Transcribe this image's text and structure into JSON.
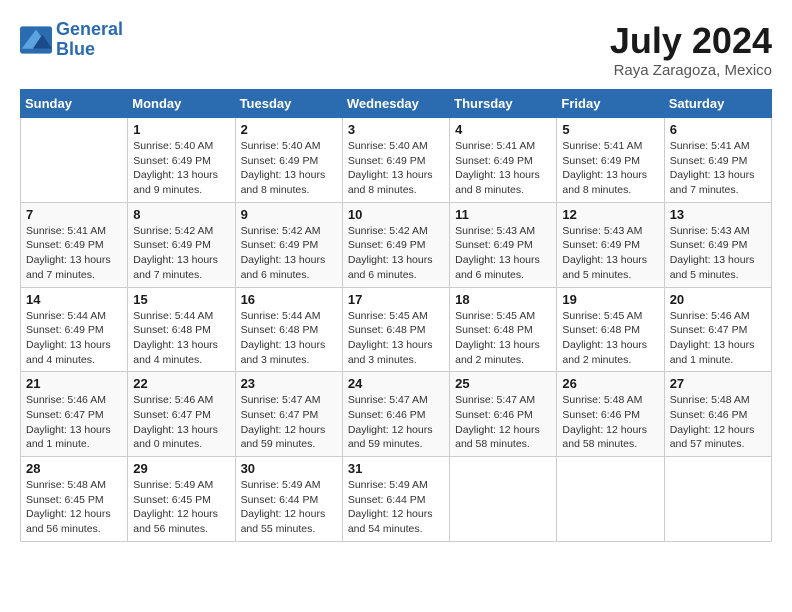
{
  "header": {
    "logo_line1": "General",
    "logo_line2": "Blue",
    "month": "July 2024",
    "location": "Raya Zaragoza, Mexico"
  },
  "weekdays": [
    "Sunday",
    "Monday",
    "Tuesday",
    "Wednesday",
    "Thursday",
    "Friday",
    "Saturday"
  ],
  "weeks": [
    [
      {
        "day": "",
        "info": ""
      },
      {
        "day": "1",
        "info": "Sunrise: 5:40 AM\nSunset: 6:49 PM\nDaylight: 13 hours\nand 9 minutes."
      },
      {
        "day": "2",
        "info": "Sunrise: 5:40 AM\nSunset: 6:49 PM\nDaylight: 13 hours\nand 8 minutes."
      },
      {
        "day": "3",
        "info": "Sunrise: 5:40 AM\nSunset: 6:49 PM\nDaylight: 13 hours\nand 8 minutes."
      },
      {
        "day": "4",
        "info": "Sunrise: 5:41 AM\nSunset: 6:49 PM\nDaylight: 13 hours\nand 8 minutes."
      },
      {
        "day": "5",
        "info": "Sunrise: 5:41 AM\nSunset: 6:49 PM\nDaylight: 13 hours\nand 8 minutes."
      },
      {
        "day": "6",
        "info": "Sunrise: 5:41 AM\nSunset: 6:49 PM\nDaylight: 13 hours\nand 7 minutes."
      }
    ],
    [
      {
        "day": "7",
        "info": "Sunrise: 5:41 AM\nSunset: 6:49 PM\nDaylight: 13 hours\nand 7 minutes."
      },
      {
        "day": "8",
        "info": "Sunrise: 5:42 AM\nSunset: 6:49 PM\nDaylight: 13 hours\nand 7 minutes."
      },
      {
        "day": "9",
        "info": "Sunrise: 5:42 AM\nSunset: 6:49 PM\nDaylight: 13 hours\nand 6 minutes."
      },
      {
        "day": "10",
        "info": "Sunrise: 5:42 AM\nSunset: 6:49 PM\nDaylight: 13 hours\nand 6 minutes."
      },
      {
        "day": "11",
        "info": "Sunrise: 5:43 AM\nSunset: 6:49 PM\nDaylight: 13 hours\nand 6 minutes."
      },
      {
        "day": "12",
        "info": "Sunrise: 5:43 AM\nSunset: 6:49 PM\nDaylight: 13 hours\nand 5 minutes."
      },
      {
        "day": "13",
        "info": "Sunrise: 5:43 AM\nSunset: 6:49 PM\nDaylight: 13 hours\nand 5 minutes."
      }
    ],
    [
      {
        "day": "14",
        "info": "Sunrise: 5:44 AM\nSunset: 6:49 PM\nDaylight: 13 hours\nand 4 minutes."
      },
      {
        "day": "15",
        "info": "Sunrise: 5:44 AM\nSunset: 6:48 PM\nDaylight: 13 hours\nand 4 minutes."
      },
      {
        "day": "16",
        "info": "Sunrise: 5:44 AM\nSunset: 6:48 PM\nDaylight: 13 hours\nand 3 minutes."
      },
      {
        "day": "17",
        "info": "Sunrise: 5:45 AM\nSunset: 6:48 PM\nDaylight: 13 hours\nand 3 minutes."
      },
      {
        "day": "18",
        "info": "Sunrise: 5:45 AM\nSunset: 6:48 PM\nDaylight: 13 hours\nand 2 minutes."
      },
      {
        "day": "19",
        "info": "Sunrise: 5:45 AM\nSunset: 6:48 PM\nDaylight: 13 hours\nand 2 minutes."
      },
      {
        "day": "20",
        "info": "Sunrise: 5:46 AM\nSunset: 6:47 PM\nDaylight: 13 hours\nand 1 minute."
      }
    ],
    [
      {
        "day": "21",
        "info": "Sunrise: 5:46 AM\nSunset: 6:47 PM\nDaylight: 13 hours\nand 1 minute."
      },
      {
        "day": "22",
        "info": "Sunrise: 5:46 AM\nSunset: 6:47 PM\nDaylight: 13 hours\nand 0 minutes."
      },
      {
        "day": "23",
        "info": "Sunrise: 5:47 AM\nSunset: 6:47 PM\nDaylight: 12 hours\nand 59 minutes."
      },
      {
        "day": "24",
        "info": "Sunrise: 5:47 AM\nSunset: 6:46 PM\nDaylight: 12 hours\nand 59 minutes."
      },
      {
        "day": "25",
        "info": "Sunrise: 5:47 AM\nSunset: 6:46 PM\nDaylight: 12 hours\nand 58 minutes."
      },
      {
        "day": "26",
        "info": "Sunrise: 5:48 AM\nSunset: 6:46 PM\nDaylight: 12 hours\nand 58 minutes."
      },
      {
        "day": "27",
        "info": "Sunrise: 5:48 AM\nSunset: 6:46 PM\nDaylight: 12 hours\nand 57 minutes."
      }
    ],
    [
      {
        "day": "28",
        "info": "Sunrise: 5:48 AM\nSunset: 6:45 PM\nDaylight: 12 hours\nand 56 minutes."
      },
      {
        "day": "29",
        "info": "Sunrise: 5:49 AM\nSunset: 6:45 PM\nDaylight: 12 hours\nand 56 minutes."
      },
      {
        "day": "30",
        "info": "Sunrise: 5:49 AM\nSunset: 6:44 PM\nDaylight: 12 hours\nand 55 minutes."
      },
      {
        "day": "31",
        "info": "Sunrise: 5:49 AM\nSunset: 6:44 PM\nDaylight: 12 hours\nand 54 minutes."
      },
      {
        "day": "",
        "info": ""
      },
      {
        "day": "",
        "info": ""
      },
      {
        "day": "",
        "info": ""
      }
    ]
  ]
}
